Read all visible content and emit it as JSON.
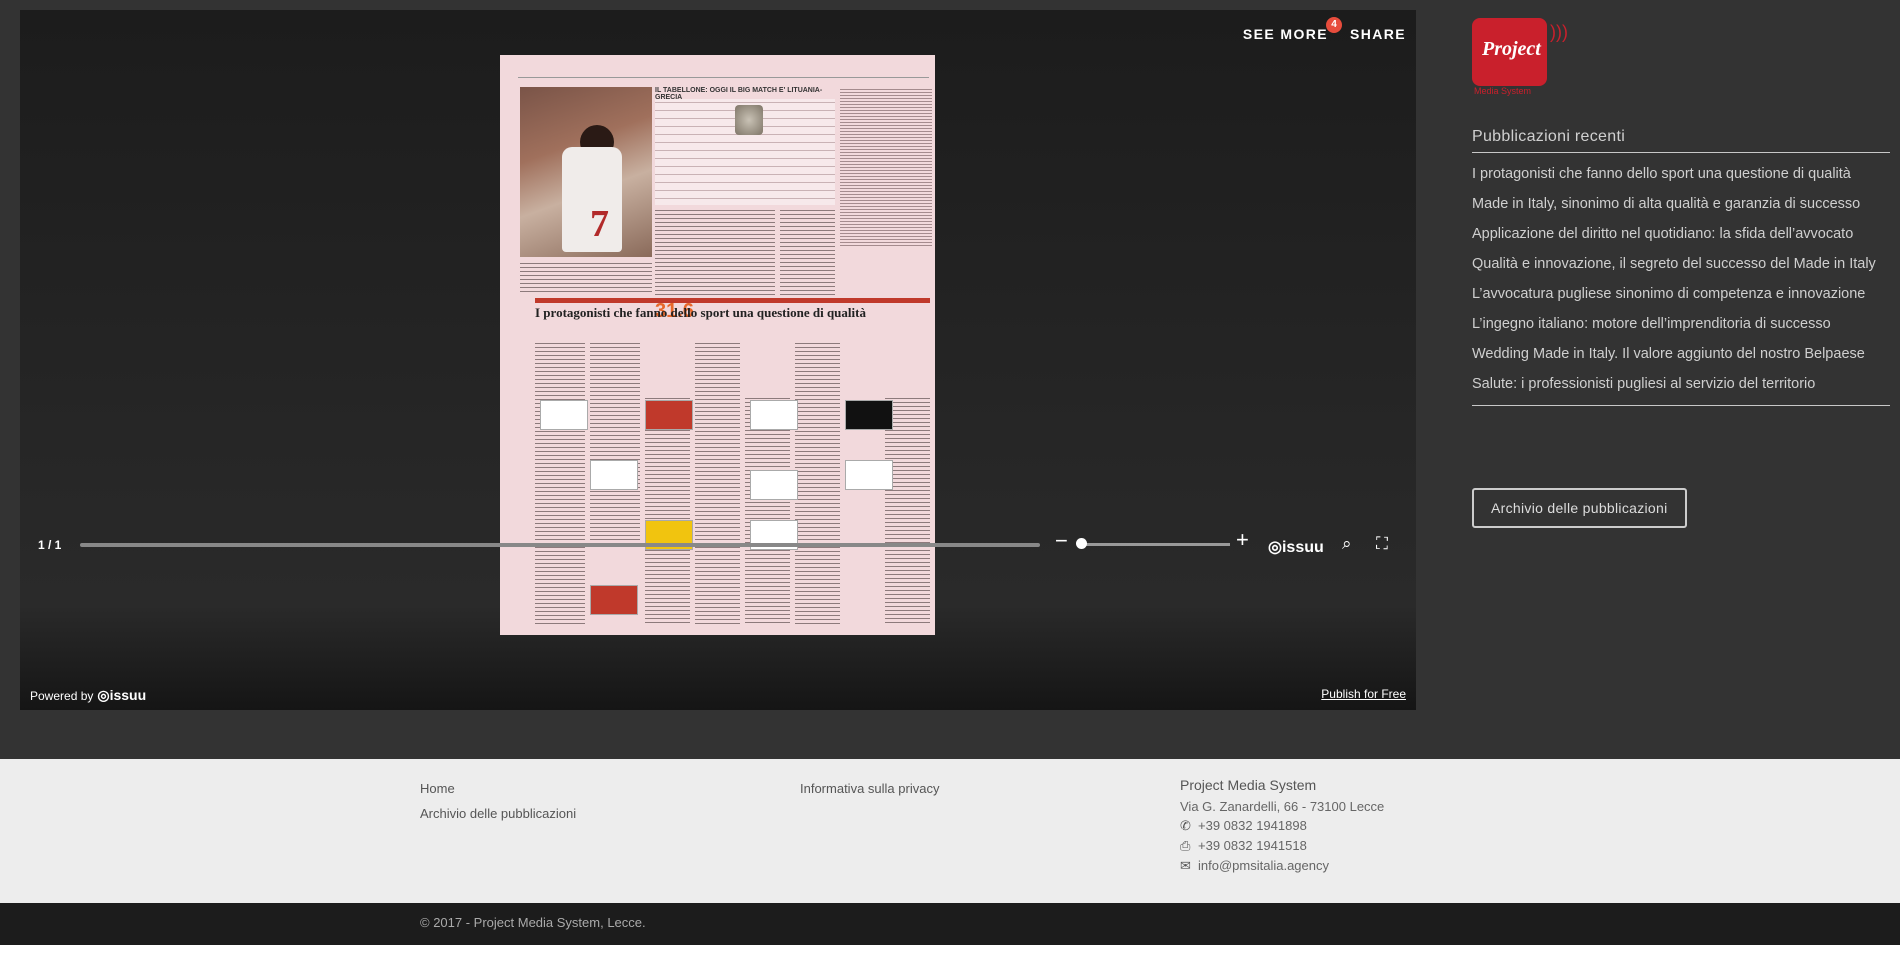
{
  "viewer": {
    "see_more_label": "SEE MORE",
    "see_more_badge": "4",
    "share_label": "SHARE",
    "page_indicator": "1 / 1",
    "powered_by_label": "Powered by",
    "issuu_brand": "issuu",
    "publish_label": "Publish for Free",
    "document": {
      "bracket_title": "IL TABELLONE: OGGI IL BIG MATCH E' LITUANIA-GRECIA",
      "headline": "I protagonisti che fanno dello sport una questione di qualità",
      "big_number": "31.6",
      "jersey_number": "7"
    }
  },
  "sidebar": {
    "logo_text": "Project",
    "logo_subtext": "Media System",
    "recent_title": "Pubblicazioni recenti",
    "recent_items": [
      "I protagonisti che fanno dello sport una questione di qualità",
      "Made in Italy, sinonimo di alta qualità e garanzia di successo",
      "Applicazione del diritto nel quotidiano: la sfida dell’avvocato",
      "Qualità e innovazione, il segreto del successo del Made in Italy",
      "L’avvocatura pugliese sinonimo di competenza e innovazione",
      "L’ingegno italiano: motore dell’imprenditoria di successo",
      "Wedding Made in Italy. Il valore aggiunto del nostro Belpaese",
      "Salute: i professionisti pugliesi al servizio del territorio"
    ],
    "archive_button": "Archivio delle pubblicazioni"
  },
  "footer": {
    "links_col1": [
      "Home",
      "Archivio delle pubblicazioni"
    ],
    "links_col2": [
      "Informativa sulla privacy"
    ],
    "company_name": "Project Media System",
    "address": "Via G. Zanardelli, 66 - 73100 Lecce",
    "phone": "+39 0832 1941898",
    "fax": "+39 0832 1941518",
    "email": "info@pmsitalia.agency",
    "copyright": "© 2017 - Project Media System, Lecce."
  },
  "icons": {
    "phone": "phone-icon",
    "fax": "fax-icon",
    "email": "envelope-icon",
    "zoom": "zoom-icon",
    "fullscreen": "fullscreen-icon"
  }
}
